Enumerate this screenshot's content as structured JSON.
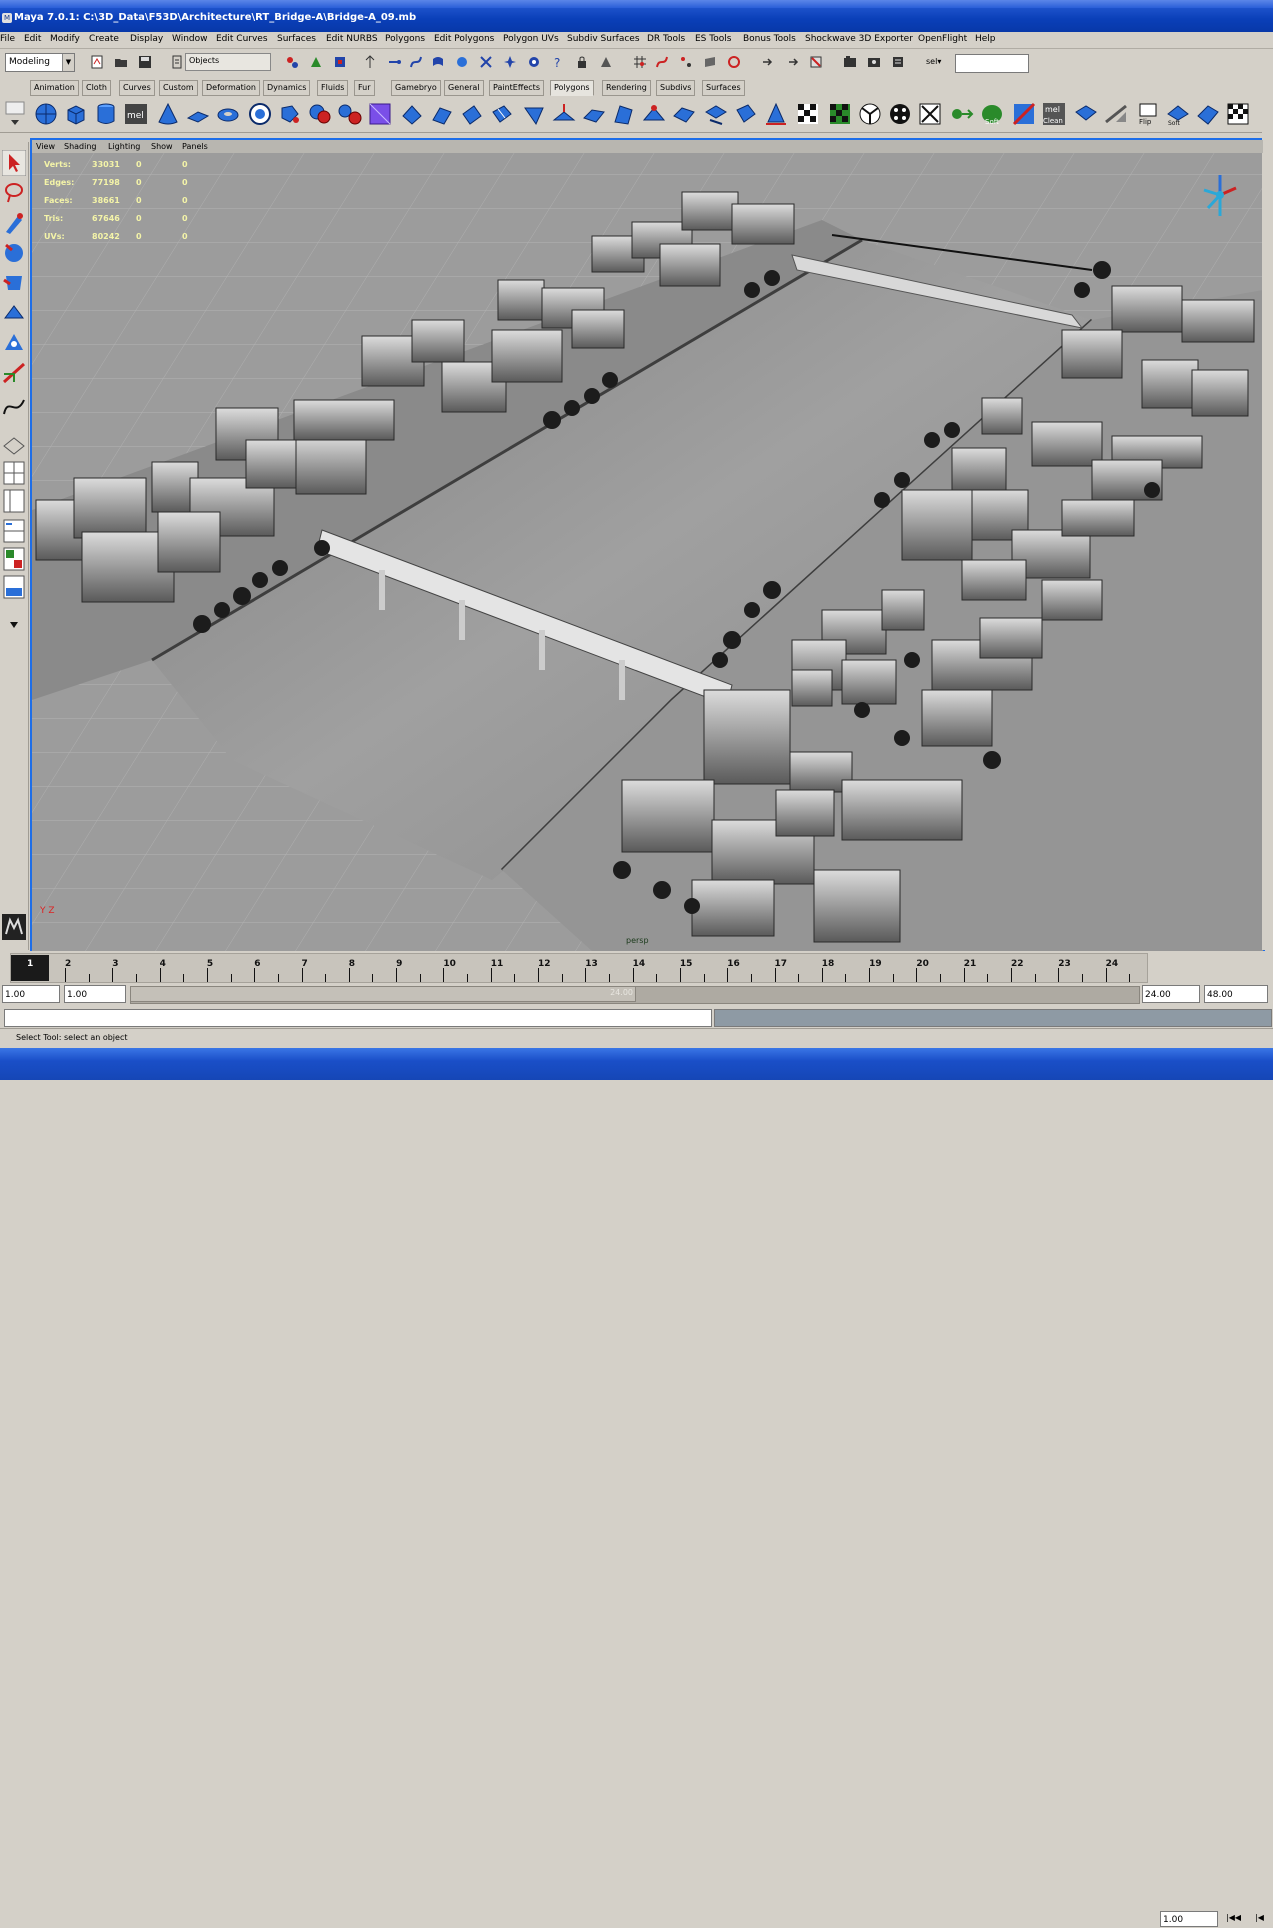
{
  "window": {
    "title": "Maya 7.0.1: C:\\3D_Data\\F53D\\Architecture\\RT_Bridge-A\\Bridge-A_09.mb",
    "icon_label": "M"
  },
  "menus": [
    "File",
    "Edit",
    "Modify",
    "Create",
    "Display",
    "Window",
    "Edit Curves",
    "Surfaces",
    "Edit NURBS",
    "Polygons",
    "Edit Polygons",
    "Polygon UVs",
    "Subdiv Surfaces",
    "DR Tools",
    "ES Tools",
    "Bonus Tools",
    "Shockwave 3D Exporter",
    "OpenFlight",
    "Help"
  ],
  "status_line": {
    "mode": "Modeling",
    "object_field": "Objects",
    "sel_label": "sel▾",
    "sel_value": ""
  },
  "shelf_tabs": [
    "Animation",
    "Cloth",
    "Curves",
    "Custom",
    "Deformation",
    "Dynamics",
    "Fluids",
    "Fur",
    "Gamebryo",
    "General",
    "PaintEffects",
    "Polygons",
    "Rendering",
    "Subdivs",
    "Surfaces"
  ],
  "active_shelf_tab": "Polygons",
  "shelf_icons": [
    "poly-sphere-icon",
    "poly-cube-icon",
    "poly-cylinder-icon",
    "mel-script-icon",
    "poly-cone-icon",
    "poly-plane-icon",
    "poly-torus-icon",
    "create-polygon-icon",
    "append-polygon-icon",
    "combine-icon",
    "separate-icon",
    "boolean-icon",
    "smooth-icon",
    "extrude-face-icon",
    "extrude-edge-icon",
    "split-poly-icon",
    "wedge-face-icon",
    "poke-face-icon",
    "bevel-icon",
    "chamfer-icon",
    "merge-vertex-icon",
    "collapse-icon",
    "delete-edge-icon",
    "planar-map-icon",
    "cylindrical-map-icon",
    "spherical-map-icon",
    "auto-map-icon",
    "uv-editor-icon",
    "checker-icon",
    "cleanup-icon",
    "soft-select-icon",
    "select-edge-loop-icon",
    "softening-icon",
    "mel-clean-icon",
    "normals-icon",
    "flip-icon",
    "soft-icon",
    "triangulate-icon",
    "quadrangulate-icon",
    "checker-map-icon"
  ],
  "shelf_icon_labels": {
    "mel": "mel",
    "mel_clean_a": "mel",
    "mel_clean_b": "Clean",
    "flip": "Flip",
    "soft": "Soft"
  },
  "toolbox": [
    "select-tool-icon",
    "lasso-tool-icon",
    "paint-select-icon",
    "move-tool-icon",
    "rotate-tool-icon",
    "scale-tool-icon",
    "show-manipulator-icon",
    "last-tool-icon",
    "single-perspective-icon",
    "four-view-icon",
    "outliner-layout-icon",
    "graph-editor-icon"
  ],
  "viewport": {
    "panel_menu": [
      "View",
      "Shading",
      "Lighting",
      "Show",
      "Panels"
    ],
    "camera_label": "persp",
    "axis_label": "Y Z",
    "heads_up": [
      {
        "label": "Verts:",
        "v1": "33031",
        "v2": "0",
        "v3": "0"
      },
      {
        "label": "Edges:",
        "v1": "77198",
        "v2": "0",
        "v3": "0"
      },
      {
        "label": "Faces:",
        "v1": "38661",
        "v2": "0",
        "v3": "0"
      },
      {
        "label": "Tris:",
        "v1": "67646",
        "v2": "0",
        "v3": "0"
      },
      {
        "label": "UVs:",
        "v1": "80242",
        "v2": "0",
        "v3": "0"
      }
    ],
    "colors": {
      "accent": "#1e6ee8",
      "hud_text": "#f4f4a8",
      "ground": "#9a9a9a",
      "water": "#8e8e8e"
    }
  },
  "time_slider": {
    "current_frame": "1",
    "frame_labels": [
      "2",
      "3",
      "4",
      "5",
      "6",
      "7",
      "8",
      "9",
      "10",
      "11",
      "12",
      "13",
      "14",
      "15",
      "16",
      "17",
      "18",
      "19",
      "20",
      "21",
      "22",
      "23",
      "24"
    ],
    "current_time": "1.00",
    "range_start": "1.00",
    "playback_start": "1.00",
    "slider_end_label": "24.00",
    "playback_end": "24.00",
    "range_end": "48.00",
    "step_back_icon": "|◀◀",
    "go_start_icon": "|◀"
  },
  "help_line": "Select Tool: select an object"
}
